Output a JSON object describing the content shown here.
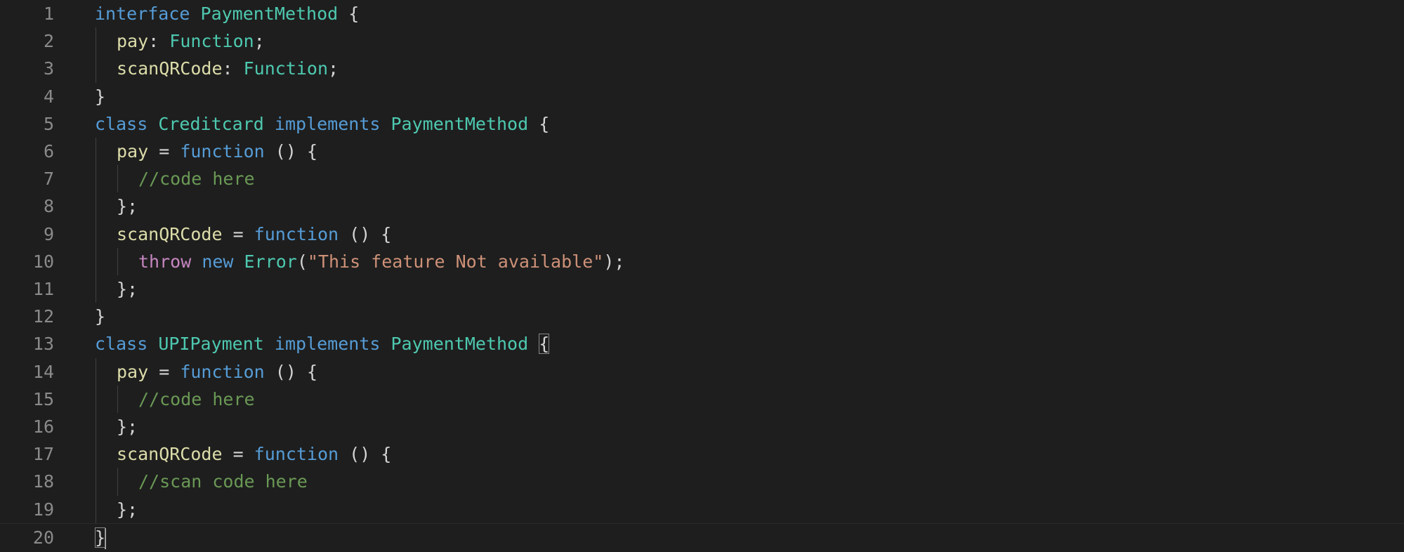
{
  "editor": {
    "lines": [
      {
        "num": "1",
        "indent": 0,
        "tokens": [
          {
            "t": "interface",
            "c": "kw"
          },
          {
            "t": " ",
            "c": "pun"
          },
          {
            "t": "PaymentMethod",
            "c": "type"
          },
          {
            "t": " {",
            "c": "pun"
          }
        ]
      },
      {
        "num": "2",
        "indent": 1,
        "tokens": [
          {
            "t": "pay",
            "c": "prop"
          },
          {
            "t": ": ",
            "c": "pun"
          },
          {
            "t": "Function",
            "c": "type"
          },
          {
            "t": ";",
            "c": "pun"
          }
        ]
      },
      {
        "num": "3",
        "indent": 1,
        "tokens": [
          {
            "t": "scanQRCode",
            "c": "prop"
          },
          {
            "t": ": ",
            "c": "pun"
          },
          {
            "t": "Function",
            "c": "type"
          },
          {
            "t": ";",
            "c": "pun"
          }
        ]
      },
      {
        "num": "4",
        "indent": 0,
        "tokens": [
          {
            "t": "}",
            "c": "pun"
          }
        ]
      },
      {
        "num": "5",
        "indent": 0,
        "tokens": [
          {
            "t": "class",
            "c": "kw"
          },
          {
            "t": " ",
            "c": "pun"
          },
          {
            "t": "Creditcard",
            "c": "type"
          },
          {
            "t": " ",
            "c": "pun"
          },
          {
            "t": "implements",
            "c": "kw"
          },
          {
            "t": " ",
            "c": "pun"
          },
          {
            "t": "PaymentMethod",
            "c": "type"
          },
          {
            "t": " {",
            "c": "pun"
          }
        ]
      },
      {
        "num": "6",
        "indent": 1,
        "tokens": [
          {
            "t": "pay",
            "c": "prop"
          },
          {
            "t": " = ",
            "c": "pun"
          },
          {
            "t": "function",
            "c": "kw"
          },
          {
            "t": " () {",
            "c": "pun"
          }
        ]
      },
      {
        "num": "7",
        "indent": 2,
        "tokens": [
          {
            "t": "//code here",
            "c": "cmt"
          }
        ]
      },
      {
        "num": "8",
        "indent": 1,
        "tokens": [
          {
            "t": "};",
            "c": "pun"
          }
        ]
      },
      {
        "num": "9",
        "indent": 1,
        "tokens": [
          {
            "t": "scanQRCode",
            "c": "prop"
          },
          {
            "t": " = ",
            "c": "pun"
          },
          {
            "t": "function",
            "c": "kw"
          },
          {
            "t": " () {",
            "c": "pun"
          }
        ]
      },
      {
        "num": "10",
        "indent": 2,
        "tokens": [
          {
            "t": "throw",
            "c": "ctrl"
          },
          {
            "t": " ",
            "c": "pun"
          },
          {
            "t": "new",
            "c": "kw"
          },
          {
            "t": " ",
            "c": "pun"
          },
          {
            "t": "Error",
            "c": "type"
          },
          {
            "t": "(",
            "c": "pun"
          },
          {
            "t": "\"This feature Not available\"",
            "c": "str"
          },
          {
            "t": ");",
            "c": "pun"
          }
        ]
      },
      {
        "num": "11",
        "indent": 1,
        "tokens": [
          {
            "t": "};",
            "c": "pun"
          }
        ]
      },
      {
        "num": "12",
        "indent": 0,
        "tokens": [
          {
            "t": "}",
            "c": "pun"
          }
        ]
      },
      {
        "num": "13",
        "indent": 0,
        "tokens": [
          {
            "t": "class",
            "c": "kw"
          },
          {
            "t": " ",
            "c": "pun"
          },
          {
            "t": "UPIPayment",
            "c": "type"
          },
          {
            "t": " ",
            "c": "pun"
          },
          {
            "t": "implements",
            "c": "kw"
          },
          {
            "t": " ",
            "c": "pun"
          },
          {
            "t": "PaymentMethod",
            "c": "type"
          },
          {
            "t": " ",
            "c": "pun"
          },
          {
            "t": "{",
            "c": "pun",
            "match": true
          }
        ]
      },
      {
        "num": "14",
        "indent": 1,
        "tokens": [
          {
            "t": "pay",
            "c": "prop"
          },
          {
            "t": " = ",
            "c": "pun"
          },
          {
            "t": "function",
            "c": "kw"
          },
          {
            "t": " () {",
            "c": "pun"
          }
        ]
      },
      {
        "num": "15",
        "indent": 2,
        "tokens": [
          {
            "t": "//code here",
            "c": "cmt"
          }
        ]
      },
      {
        "num": "16",
        "indent": 1,
        "tokens": [
          {
            "t": "};",
            "c": "pun"
          }
        ]
      },
      {
        "num": "17",
        "indent": 1,
        "tokens": [
          {
            "t": "scanQRCode",
            "c": "prop"
          },
          {
            "t": " = ",
            "c": "pun"
          },
          {
            "t": "function",
            "c": "kw"
          },
          {
            "t": " () {",
            "c": "pun"
          }
        ]
      },
      {
        "num": "18",
        "indent": 2,
        "tokens": [
          {
            "t": "//scan code here",
            "c": "cmt"
          }
        ]
      },
      {
        "num": "19",
        "indent": 1,
        "tokens": [
          {
            "t": "};",
            "c": "pun"
          }
        ]
      },
      {
        "num": "20",
        "indent": 0,
        "current": true,
        "cursor": true,
        "tokens": [
          {
            "t": "}",
            "c": "pun",
            "match": true
          }
        ]
      }
    ]
  },
  "colors": {
    "background": "#1e1e1e",
    "keyword": "#569cd6",
    "type": "#4ec9b0",
    "property": "#dcdcaa",
    "control": "#c586c0",
    "string": "#ce9178",
    "comment": "#6a9955",
    "punctuation": "#d4d4d4",
    "line_number": "#8a8a8a"
  }
}
